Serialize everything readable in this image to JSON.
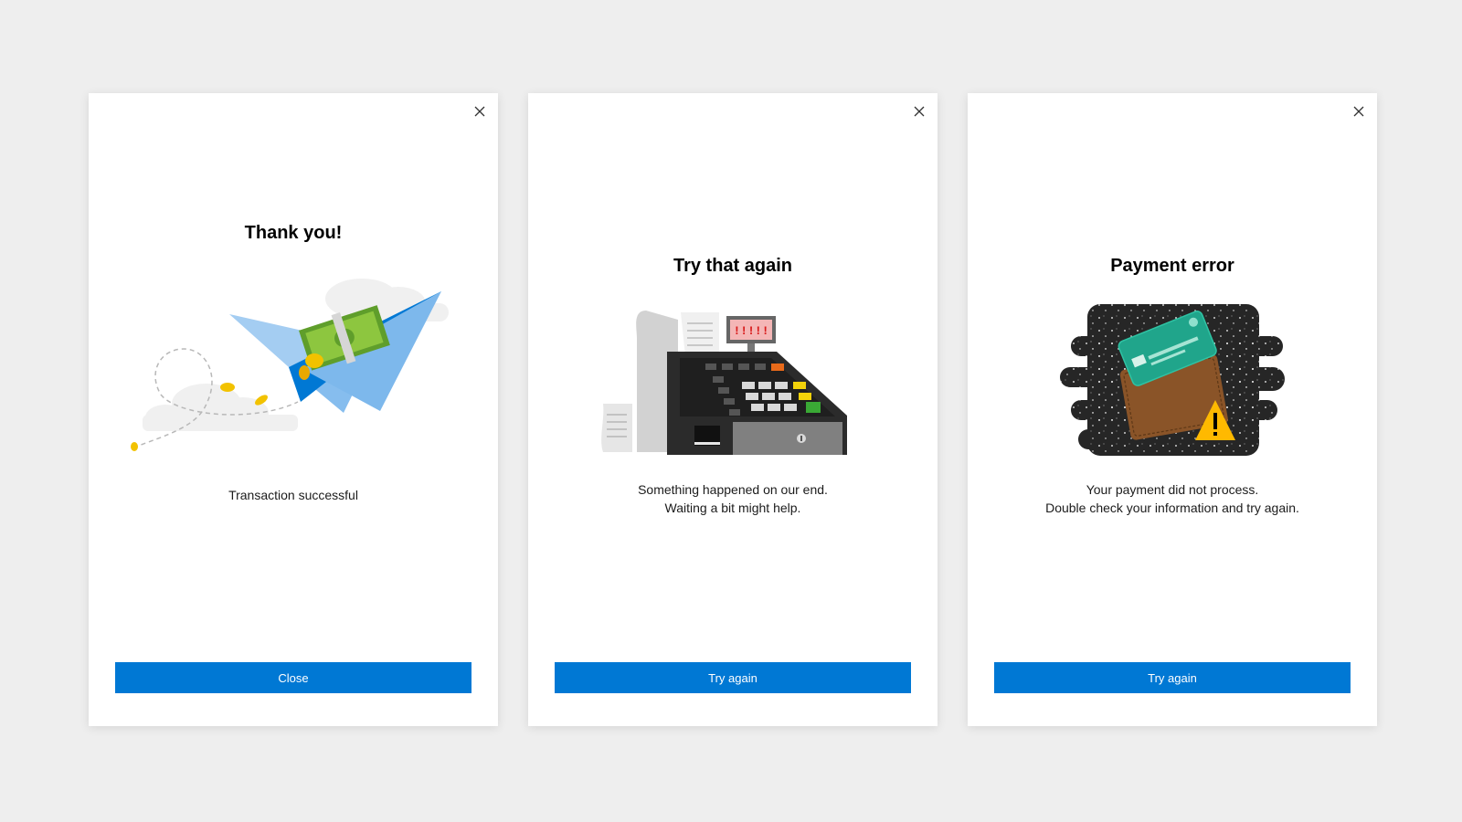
{
  "colors": {
    "background": "#eeeeee",
    "card": "#ffffff",
    "primary_button": "#0078d4",
    "warning": "#ffb900"
  },
  "dialogs": [
    {
      "title": "Thank you!",
      "illustration": "paper-plane-money",
      "message_lines": [
        "Transaction successful"
      ],
      "button_label": "Close",
      "close_icon": "close-icon"
    },
    {
      "title": "Try that again",
      "illustration": "cash-register",
      "display_text": "!!!!!",
      "message_lines": [
        "Something happened on our end.",
        "Waiting a bit might help."
      ],
      "button_label": "Try again",
      "close_icon": "close-icon"
    },
    {
      "title": "Payment error",
      "illustration": "wallet-card-warning",
      "message_lines": [
        "Your payment did not process.",
        "Double check your information and try again."
      ],
      "button_label": "Try again",
      "close_icon": "close-icon"
    }
  ]
}
